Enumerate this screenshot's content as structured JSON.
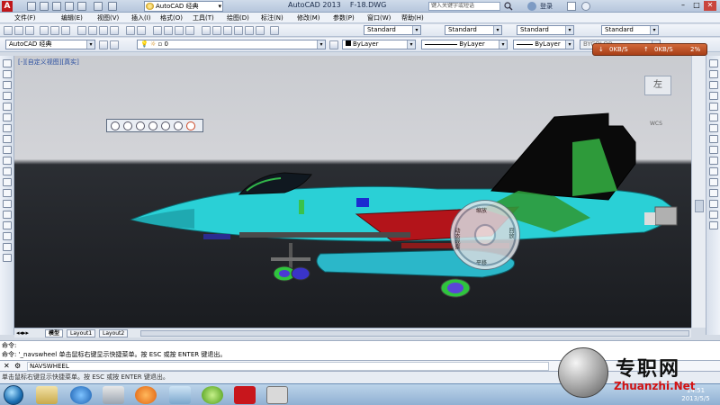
{
  "app": {
    "title": "AutoCAD 2013    F-18.DWG",
    "workspace": "AutoCAD 经典",
    "search_placeholder": "键入关键字或短语",
    "login_label": "登录"
  },
  "menu": [
    "文件(F)",
    "编辑(E)",
    "视图(V)",
    "插入(I)",
    "格式(O)",
    "工具(T)",
    "绘图(D)",
    "标注(N)",
    "修改(M)",
    "参数(P)",
    "窗口(W)",
    "帮助(H)"
  ],
  "toolbar": {
    "workspace_combo": "AutoCAD 经典",
    "layer_combo": "0",
    "text_style": "Standard",
    "dim_style": "Standard",
    "table_style": "Standard",
    "multileader_style": "Standard",
    "color_combo": "ByLayer",
    "linetype_combo": "ByLayer",
    "lineweight_combo": "ByLayer",
    "plotstyle_combo": "BYCOLOR"
  },
  "viewport": {
    "label": "[-][自定义视图][真实]",
    "viewcube_face": "左",
    "wcs": "WCS",
    "net_down": "0KB/S",
    "net_up": "0KB/S",
    "net_pct": "2%"
  },
  "steering_wheel": {
    "top": "缩放",
    "left": "动态观察",
    "right": "回放",
    "bottom": "平移"
  },
  "layout_tabs": [
    "模型",
    "Layout1",
    "Layout2"
  ],
  "command": {
    "history": [
      "命令:",
      "命令: '_navswheel 单击鼠标右键显示快捷菜单。按 ESC 或按 ENTER 键退出。"
    ],
    "input": "NAVSWHEEL",
    "status": "单击鼠标右键显示快捷菜单。按 ESC 或按 ENTER 键退出。"
  },
  "taskbar": {
    "time": "14:51",
    "date": "2013/5/5"
  },
  "watermark": {
    "title": "专职网",
    "url": "Zhuanzhi.Net"
  },
  "colors": {
    "jet_cyan": "#2ad0d6",
    "jet_green": "#2e9a3a",
    "jet_red": "#b3141a",
    "jet_black": "#0a0a0a"
  }
}
